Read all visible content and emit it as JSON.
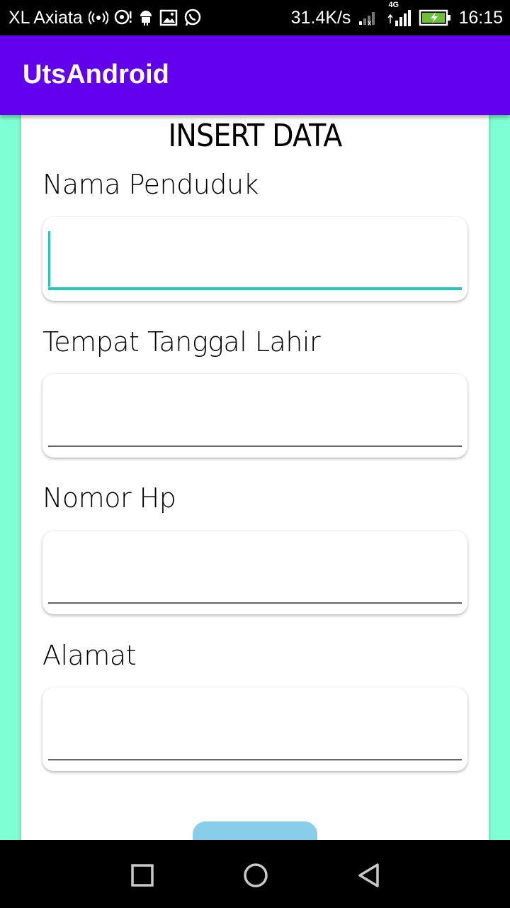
{
  "status_bar": {
    "carrier": "XL Axiata",
    "speed": "31.4K/s",
    "network": "4G",
    "time": "16:15",
    "icons": [
      "hotspot-icon",
      "chat-icon",
      "android-icon",
      "image-icon",
      "whatsapp-icon",
      "signal-icon",
      "signal-4g-icon",
      "battery-charging-icon"
    ]
  },
  "app_bar": {
    "title": "UtsAndroid"
  },
  "form": {
    "heading": "INSERT DATA",
    "fields": [
      {
        "label": "Nama Penduduk",
        "value": ""
      },
      {
        "label": "Tempat Tanggal Lahir",
        "value": ""
      },
      {
        "label": "Nomor Hp",
        "value": ""
      },
      {
        "label": "Alamat",
        "value": ""
      }
    ]
  },
  "nav_bar": {
    "icons": [
      "recent-apps-icon",
      "home-icon",
      "back-icon"
    ]
  },
  "colors": {
    "app_bar": "#6200ee",
    "background": "#7fffd4",
    "accent": "#26c6b5",
    "button": "#87ceeb"
  }
}
